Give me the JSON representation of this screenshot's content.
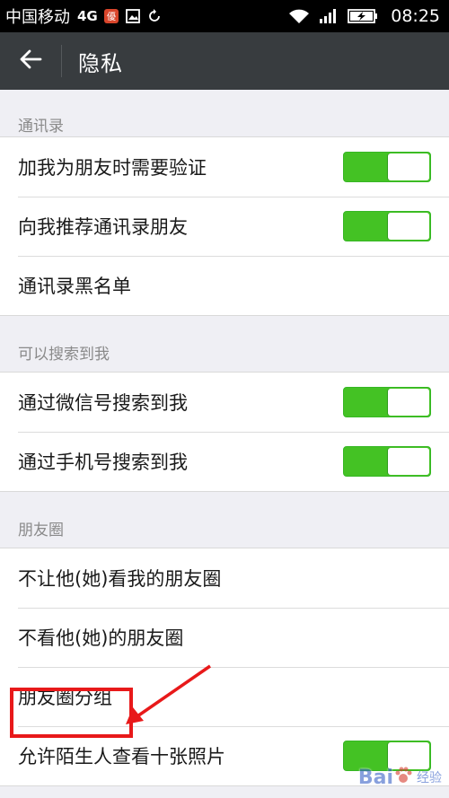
{
  "status_bar": {
    "carrier": "中国移动",
    "network": "4G",
    "time": "08:25",
    "icons": [
      "unicom-badge-icon",
      "image-icon",
      "sync-icon",
      "wifi-icon",
      "signal-icon",
      "battery-charging-icon"
    ]
  },
  "header": {
    "back_icon": "back-arrow-icon",
    "title": "隐私"
  },
  "sections": [
    {
      "title": "通讯录",
      "items": [
        {
          "label": "加我为朋友时需要验证",
          "toggle": true
        },
        {
          "label": "向我推荐通讯录朋友",
          "toggle": true
        },
        {
          "label": "通讯录黑名单",
          "toggle": null
        }
      ]
    },
    {
      "title": "可以搜索到我",
      "items": [
        {
          "label": "通过微信号搜索到我",
          "toggle": true
        },
        {
          "label": "通过手机号搜索到我",
          "toggle": true
        }
      ]
    },
    {
      "title": "朋友圈",
      "items": [
        {
          "label": "不让他(她)看我的朋友圈",
          "toggle": null
        },
        {
          "label": "不看他(她)的朋友圈",
          "toggle": null
        },
        {
          "label": "朋友圈分组",
          "toggle": null
        },
        {
          "label": "允许陌生人查看十张照片",
          "toggle": true
        }
      ]
    }
  ],
  "annotation": {
    "highlighted_item": "朋友圈分组",
    "color": "#e8191a"
  },
  "watermark": {
    "text": "Bai",
    "sub": "经验"
  },
  "colors": {
    "toggle_on": "#44c224",
    "titlebar": "#383c3f",
    "background": "#efeff4"
  }
}
